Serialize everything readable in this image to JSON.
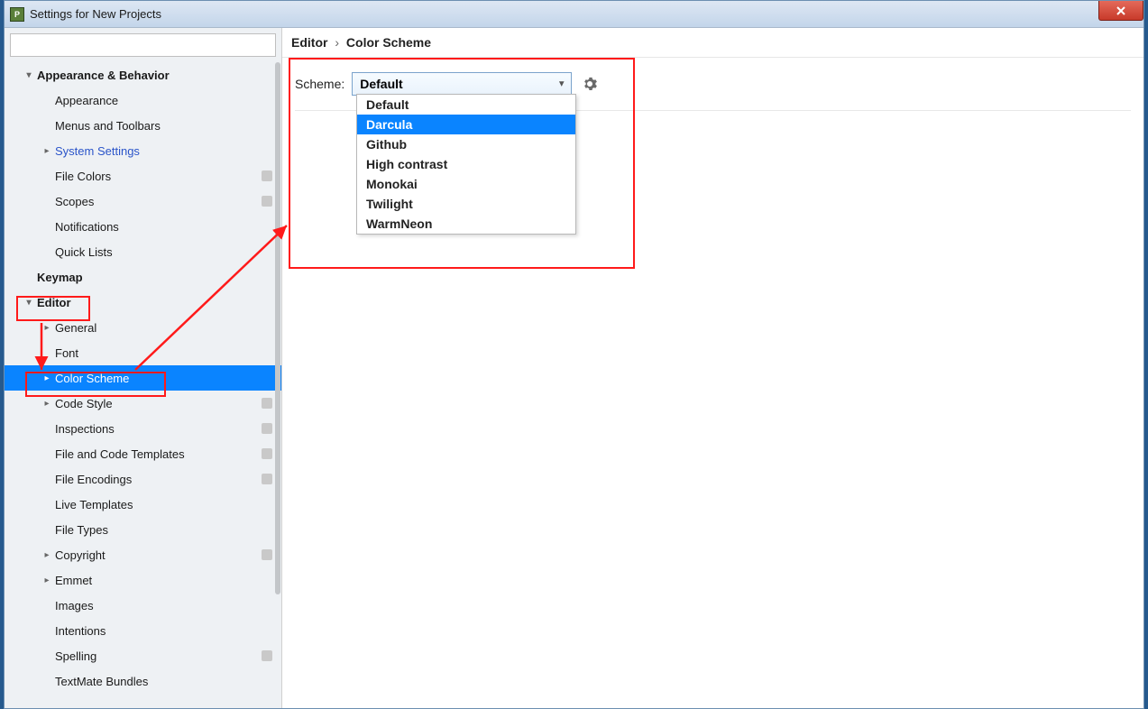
{
  "window": {
    "title": "Settings for New Projects"
  },
  "search": {
    "placeholder": ""
  },
  "sidebar": {
    "appearance_behavior": "Appearance & Behavior",
    "appearance": "Appearance",
    "menus_toolbars": "Menus and Toolbars",
    "system_settings": "System Settings",
    "file_colors": "File Colors",
    "scopes": "Scopes",
    "notifications": "Notifications",
    "quick_lists": "Quick Lists",
    "keymap": "Keymap",
    "editor": "Editor",
    "general": "General",
    "font": "Font",
    "color_scheme": "Color Scheme",
    "code_style": "Code Style",
    "inspections": "Inspections",
    "file_code_templates": "File and Code Templates",
    "file_encodings": "File Encodings",
    "live_templates": "Live Templates",
    "file_types": "File Types",
    "copyright": "Copyright",
    "emmet": "Emmet",
    "images": "Images",
    "intentions": "Intentions",
    "spelling": "Spelling",
    "textmate_bundles": "TextMate Bundles"
  },
  "breadcrumb": {
    "p1": "Editor",
    "sep": "›",
    "p2": "Color Scheme"
  },
  "scheme": {
    "label": "Scheme:",
    "selected": "Default",
    "options": [
      "Default",
      "Darcula",
      "Github",
      "High contrast",
      "Monokai",
      "Twilight",
      "WarmNeon"
    ]
  }
}
